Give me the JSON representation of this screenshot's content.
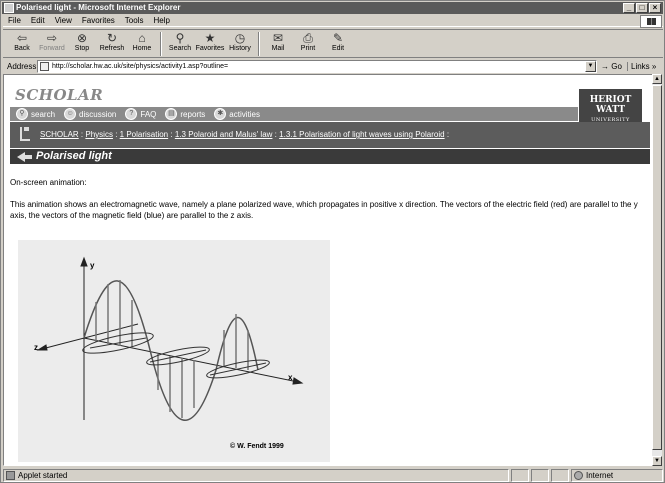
{
  "window": {
    "title": "Polarised light - Microsoft Internet Explorer",
    "min": "_",
    "max": "□",
    "close": "×"
  },
  "menu": [
    "File",
    "Edit",
    "View",
    "Favorites",
    "Tools",
    "Help"
  ],
  "toolbar": {
    "back": "Back",
    "forward": "Forward",
    "stop": "Stop",
    "refresh": "Refresh",
    "home": "Home",
    "search": "Search",
    "favorites": "Favorites",
    "history": "History",
    "mail": "Mail",
    "print": "Print",
    "edit": "Edit"
  },
  "address": {
    "label": "Address",
    "url": "http://scholar.hw.ac.uk/site/physics/activity1.asp?outline=",
    "go": "Go",
    "links": "Links »"
  },
  "site": {
    "logo": "SCHOLAR",
    "brand_line1": "HERIOT",
    "brand_line2": "WATT",
    "brand_line3": "UNIVERSITY",
    "nav": [
      "search",
      "discussion",
      "FAQ",
      "reports",
      "activities"
    ],
    "breadcrumb": {
      "scholar": "SCHOLAR",
      "physics": "Physics",
      "polarisation": "1 Polarisation",
      "polaroid": "1.3 Polaroid and Malus' law",
      "polaroid_waves": "1.3.1 Polarisation of light waves using Polaroid",
      "sep": ":",
      "tail": ":"
    },
    "page_title": "Polarised light"
  },
  "content": {
    "intro": "On-screen animation:",
    "description": "This animation shows an electromagnetic wave, namely a plane polarized wave, which propagates in positive x direction. The vectors of the electric field (red) are parallel to the y axis, the vectors of the magnetic field (blue) are parallel to the z axis.",
    "applet_axis_y": "y",
    "applet_axis_z": "z",
    "applet_axis_x": "x",
    "applet_credit": "© W. Fendt 1999"
  },
  "status": {
    "text": "Applet started",
    "zone": "Internet"
  }
}
